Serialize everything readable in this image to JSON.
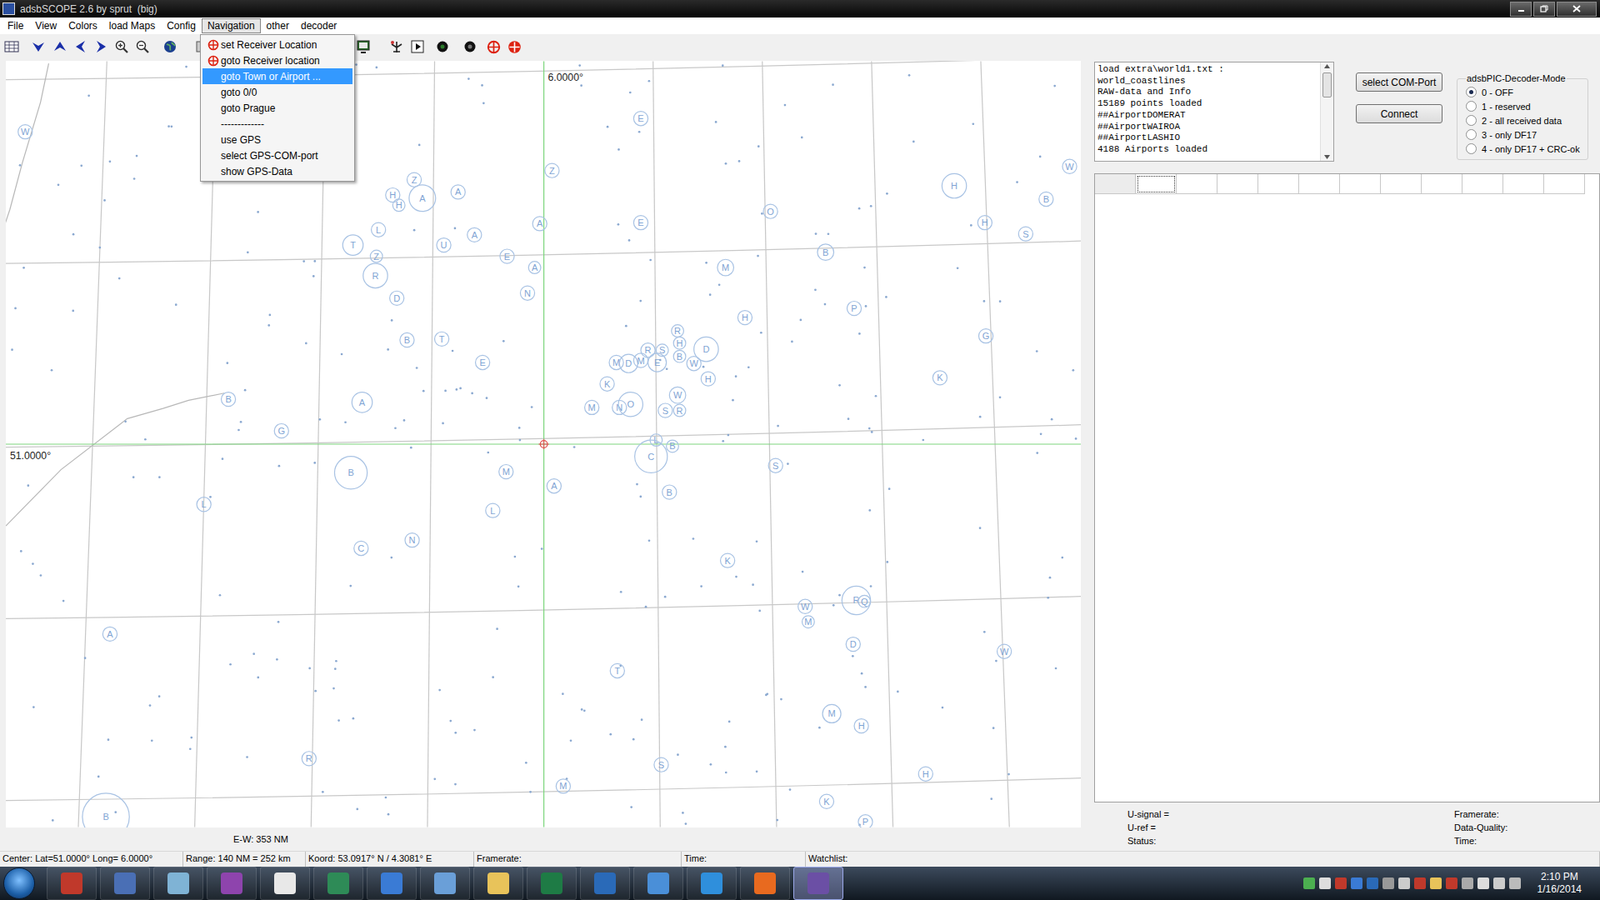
{
  "window": {
    "title": "adsbSCOPE 2.6 by sprut  (big)"
  },
  "menu": [
    {
      "label": "File",
      "open": false
    },
    {
      "label": "View",
      "open": false
    },
    {
      "label": "Colors",
      "open": false
    },
    {
      "label": "load Maps",
      "open": false
    },
    {
      "label": "Config",
      "open": false
    },
    {
      "label": "Navigation",
      "open": true
    },
    {
      "label": "other",
      "open": false
    },
    {
      "label": "decoder",
      "open": false
    }
  ],
  "dropdown": {
    "items": [
      {
        "label": "set Receiver Location",
        "kind": "icon",
        "selected": false
      },
      {
        "label": "goto Receiver location",
        "kind": "icon",
        "selected": false
      },
      {
        "label": "goto Town or Airport ...",
        "kind": "plain",
        "selected": true
      },
      {
        "label": "goto 0/0",
        "kind": "plain",
        "selected": false
      },
      {
        "label": "goto Prague",
        "kind": "plain",
        "selected": false
      },
      {
        "label": "-------------",
        "kind": "separator",
        "selected": false
      },
      {
        "label": "use GPS",
        "kind": "plain",
        "selected": false
      },
      {
        "label": "select GPS-COM-port",
        "kind": "plain",
        "selected": false
      },
      {
        "label": "show GPS-Data",
        "kind": "plain",
        "selected": false
      }
    ]
  },
  "map": {
    "lon_label": "6.0000°",
    "lat_label": "51.0000°",
    "scale": "E-W: 353 NM",
    "airports": [
      {
        "label": "W"
      },
      {
        "label": "E"
      },
      {
        "label": "Z"
      },
      {
        "label": "H"
      },
      {
        "label": "H"
      },
      {
        "label": "A"
      },
      {
        "label": "A"
      },
      {
        "label": "Z"
      },
      {
        "label": "A"
      },
      {
        "label": "E"
      },
      {
        "label": "O"
      },
      {
        "label": "H"
      },
      {
        "label": "W"
      },
      {
        "label": "B"
      },
      {
        "label": "H"
      },
      {
        "label": "S"
      },
      {
        "label": "L"
      },
      {
        "label": "T"
      },
      {
        "label": "U"
      },
      {
        "label": "A"
      },
      {
        "label": "Z"
      },
      {
        "label": "R"
      },
      {
        "label": "E"
      },
      {
        "label": "A"
      },
      {
        "label": "B"
      },
      {
        "label": "M"
      },
      {
        "label": "N"
      },
      {
        "label": "D"
      },
      {
        "label": "P"
      },
      {
        "label": "H"
      },
      {
        "label": "G"
      },
      {
        "label": "R"
      },
      {
        "label": "B"
      },
      {
        "label": "T"
      },
      {
        "label": "H"
      },
      {
        "label": "R"
      },
      {
        "label": "S"
      },
      {
        "label": "D"
      },
      {
        "label": "B"
      },
      {
        "label": "M"
      },
      {
        "label": "D"
      },
      {
        "label": "M"
      },
      {
        "label": "E"
      },
      {
        "label": "W"
      },
      {
        "label": "E"
      },
      {
        "label": "H"
      },
      {
        "label": "K"
      },
      {
        "label": "W"
      },
      {
        "label": "K"
      },
      {
        "label": "B"
      },
      {
        "label": "A"
      },
      {
        "label": "M"
      },
      {
        "label": "N"
      },
      {
        "label": "O"
      },
      {
        "label": "S"
      },
      {
        "label": "R"
      },
      {
        "label": "G"
      },
      {
        "label": "L"
      },
      {
        "label": "B"
      },
      {
        "label": "C"
      },
      {
        "label": "S"
      },
      {
        "label": "B"
      },
      {
        "label": "M"
      },
      {
        "label": "A"
      },
      {
        "label": "B"
      },
      {
        "label": "L"
      },
      {
        "label": "L"
      },
      {
        "label": "N"
      },
      {
        "label": "C"
      },
      {
        "label": "K"
      },
      {
        "label": "R"
      },
      {
        "label": "Q"
      },
      {
        "label": "W"
      },
      {
        "label": "M"
      },
      {
        "label": "A"
      },
      {
        "label": "D"
      },
      {
        "label": "W"
      },
      {
        "label": "T"
      },
      {
        "label": "M"
      },
      {
        "label": "H"
      },
      {
        "label": "R"
      },
      {
        "label": "S"
      },
      {
        "label": "H"
      },
      {
        "label": "M"
      },
      {
        "label": "K"
      },
      {
        "label": "B"
      },
      {
        "label": "P"
      }
    ]
  },
  "log": {
    "lines": [
      "load extra\\world1.txt :",
      "world_coastlines",
      "RAW-data and Info",
      "15189 points loaded",
      "##AirportDOMERAT",
      "##AirportWAIROA",
      "##AirportLASHIO",
      "4188 Airports loaded"
    ]
  },
  "buttons": [
    "select COM-Port",
    "Connect"
  ],
  "decoder_mode": {
    "title": "adsbPIC-Decoder-Mode",
    "options": [
      {
        "label": "0 - OFF",
        "selected": true
      },
      {
        "label": "1 - reserved",
        "selected": false
      },
      {
        "label": "2 - all received data",
        "selected": false
      },
      {
        "label": "3 - only DF17",
        "selected": false
      },
      {
        "label": "4 - only DF17 + CRC-ok",
        "selected": false
      }
    ]
  },
  "table": {
    "columns": [
      {
        "label": "",
        "selected": false
      },
      {
        "label": "",
        "selected": true
      },
      {
        "label": "",
        "selected": false
      },
      {
        "label": "",
        "selected": false
      },
      {
        "label": "",
        "selected": false
      },
      {
        "label": "",
        "selected": false
      },
      {
        "label": "",
        "selected": false
      },
      {
        "label": "",
        "selected": false
      },
      {
        "label": "",
        "selected": false
      },
      {
        "label": "",
        "selected": false
      },
      {
        "label": "",
        "selected": false
      },
      {
        "label": "",
        "selected": false
      }
    ]
  },
  "readings": {
    "left": [
      "U-signal =",
      "U-ref =",
      "Status:"
    ],
    "right": [
      "Framerate:",
      "Data-Quality:",
      "Time:"
    ]
  },
  "status_bar": [
    "Center: Lat=51.0000° Long= 6.0000°",
    "Range: 140 NM = 252 km",
    "Koord: 53.0917° N / 4.3081° E",
    "Framerate:",
    "Time:",
    "Watchlist:"
  ],
  "taskbar": {
    "time": "2:10 PM",
    "date": "1/16/2014"
  }
}
